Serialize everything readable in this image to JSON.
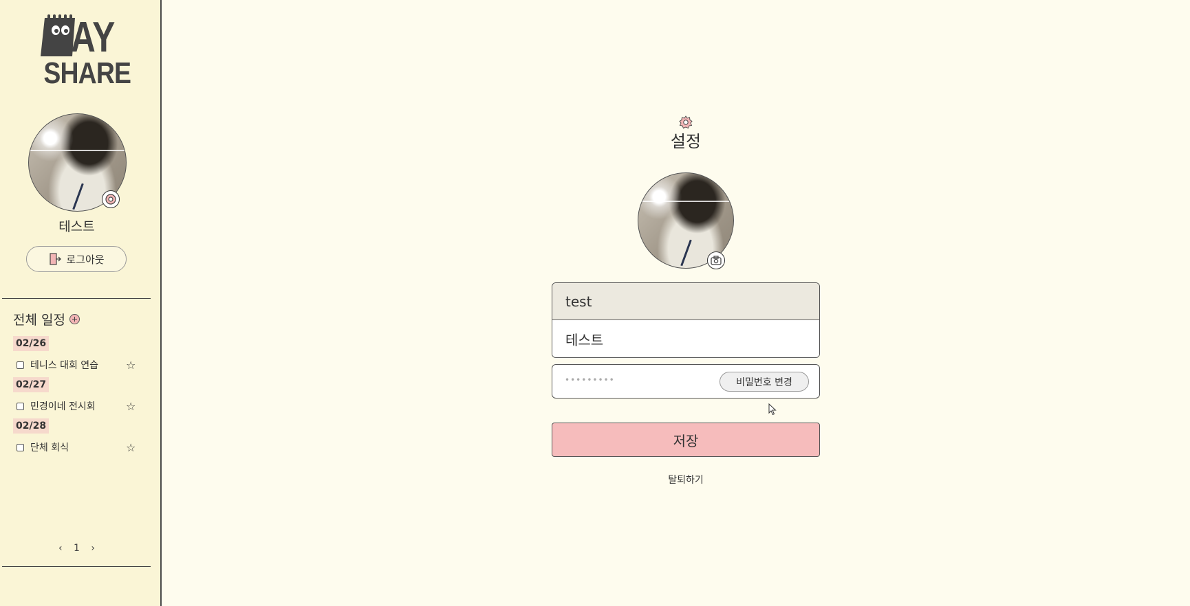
{
  "app": {
    "logo_text_top": "AY",
    "logo_text_bottom": "SHARE"
  },
  "sidebar": {
    "user_name": "테스트",
    "logout_label": "로그아웃",
    "schedule_title": "전체 일정",
    "groups": [
      {
        "date": "02/26",
        "items": [
          {
            "title": "테니스 대회 연습",
            "checked": false,
            "starred": false
          }
        ]
      },
      {
        "date": "02/27",
        "items": [
          {
            "title": "민경이네 전시회",
            "checked": false,
            "starred": false
          }
        ]
      },
      {
        "date": "02/28",
        "items": [
          {
            "title": "단체 회식",
            "checked": false,
            "starred": false
          }
        ]
      }
    ],
    "pager": {
      "prev": "‹",
      "page": "1",
      "next": "›"
    }
  },
  "settings": {
    "title": "설정",
    "user_id": "test",
    "nickname": "테스트",
    "password_mask": "•••••••••",
    "change_password_label": "비밀번호 변경",
    "save_label": "저장",
    "withdraw_label": "탈퇴하기"
  },
  "colors": {
    "background": "#fefcee",
    "sidebar_bg": "#faf5d6",
    "save_button": "#f6bcbc",
    "date_chip": "#f6d9cc",
    "accent_pink": "#f2b5b5"
  },
  "icons": [
    "logo-calendar-icon",
    "gear-icon",
    "logout-icon",
    "add-icon",
    "star-icon",
    "camera-icon"
  ]
}
